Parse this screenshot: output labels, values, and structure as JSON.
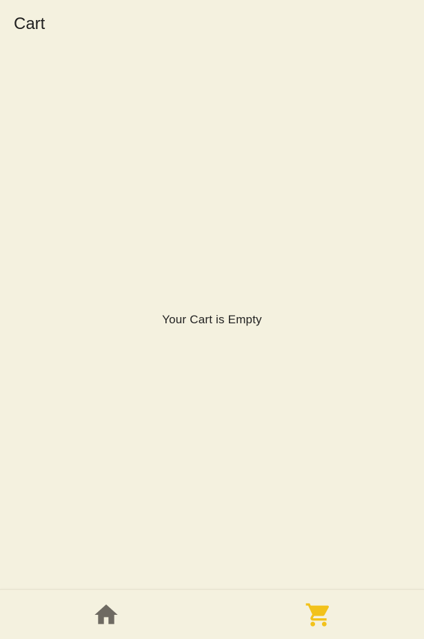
{
  "header": {
    "title": "Cart"
  },
  "main": {
    "empty_message": "Your Cart is Empty"
  },
  "bottom_nav": {
    "items": [
      {
        "icon": "home-icon",
        "active": false,
        "color": "#6e6a62"
      },
      {
        "icon": "shopping-cart-icon",
        "active": true,
        "color": "#f2c21b"
      }
    ]
  },
  "colors": {
    "background": "#f4f1df",
    "text": "#1f1f1f",
    "accent": "#f2c21b",
    "inactive_icon": "#6e6a62"
  }
}
